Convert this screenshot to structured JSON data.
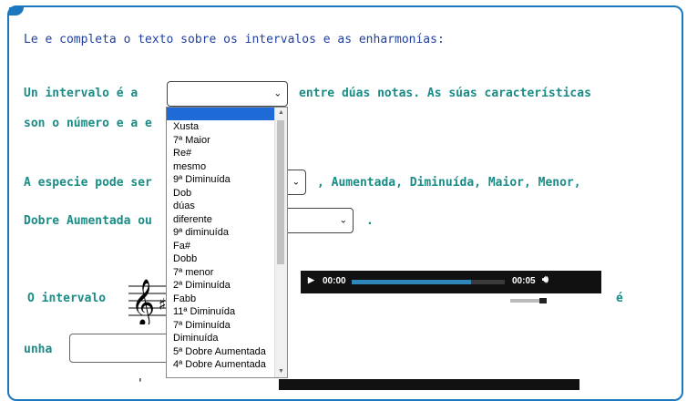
{
  "instruction": "Le e completa o texto sobre os intervalos e as enharmonías:",
  "line1": {
    "before": "Un intervalo é a",
    "after": "entre dúas notas. As súas características"
  },
  "line2": {
    "text": "son o número e a e"
  },
  "line3": {
    "before": "A especie pode ser",
    "after": ", Aumentada, Diminuída, Maior, Menor,"
  },
  "line4": {
    "before": "Dobre Aumentada ou",
    "after": "."
  },
  "line5": {
    "before": "O intervalo",
    "after": "é"
  },
  "line6": {
    "text": "unha"
  },
  "line7": {
    "text": "'"
  },
  "clef": {
    "glyph": "𝄞",
    "accidental": "♯"
  },
  "audio1": {
    "current_time": "00:00",
    "duration": "00:05",
    "progress": 0.78,
    "volume": 0.75
  },
  "dropdown": {
    "options": [
      "",
      "Xusta",
      "7ª Maior",
      "Re#",
      "mesmo",
      "9ª Diminuída",
      "Dob",
      "dúas",
      "diferente",
      "9ª diminuída",
      "Fa#",
      "Dobb",
      "7ª menor",
      "2ª Diminuída",
      "Fabb",
      "11ª Diminuída",
      "7ª Diminuída",
      "Diminuída",
      "5ª Dobre Aumentada",
      "4ª Dobre Aumentada"
    ],
    "selected_index": 0
  },
  "colors": {
    "accent": "#1b78be",
    "teal_text": "#1a8c86",
    "intro_text": "#1f3fa0",
    "highlight": "#1e6ad6"
  }
}
